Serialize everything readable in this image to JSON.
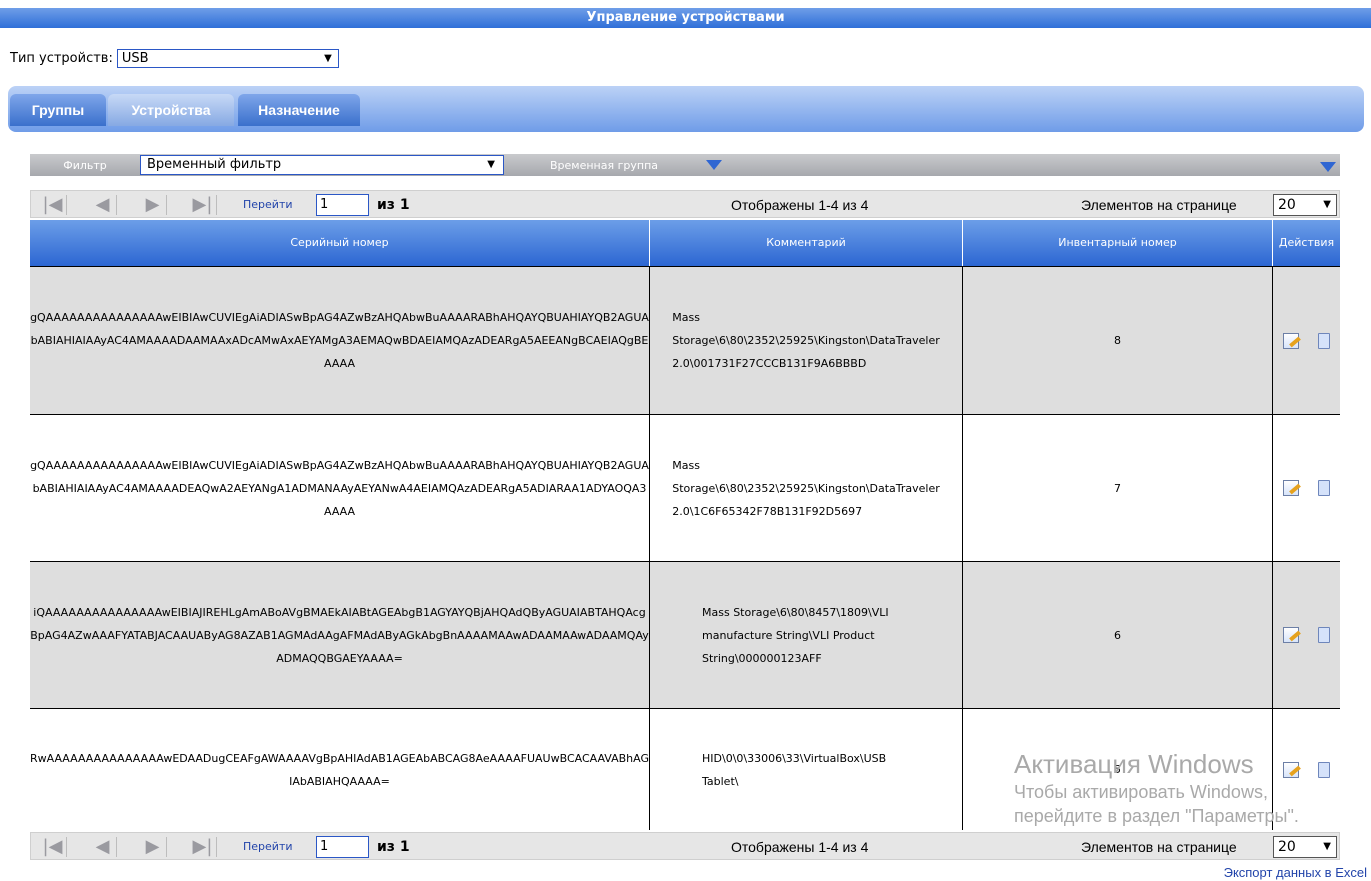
{
  "app": {
    "title": "Управление устройствами"
  },
  "device_type": {
    "label": "Тип устройств:",
    "value": "USB"
  },
  "tabs": [
    {
      "label": "Группы"
    },
    {
      "label": "Устройства"
    },
    {
      "label": "Назначение"
    }
  ],
  "filter": {
    "label": "Фильтр",
    "value": "Временный фильтр",
    "group_label": "Временная группа"
  },
  "pager": {
    "goto_label": "Перейти",
    "page_value": "1",
    "of_label": "из 1",
    "shown_text": "Отображены 1-4 из 4",
    "per_page_label": "Элементов на странице",
    "per_page_value": "20"
  },
  "table": {
    "columns": [
      "Серийный номер",
      "Комментарий",
      "Инвентарный номер",
      "Действия"
    ],
    "rows": [
      {
        "serial": "gQAAAAAAAAAAAAAAAwEIBIAwCUVIEgAiADIASwBpAG4AZwBzAHQAbwBuAAAARABhAHQAYQBUAHIAYQB2AGUAbABIAHIAIAAyAC4AMAAAADAAMAAxADcAMwAxAEYAMgA3AEMAQwBDAEIAMQAzADEARgA5AEEANgBCAEIAQgBEAAAA",
        "comment": "Mass Storage\\6\\80\\2352\\25925\\Kingston\\DataTraveler 2.0\\001731F27CCCB131F9A6BBBD",
        "inventory": "8"
      },
      {
        "serial": "gQAAAAAAAAAAAAAAAwEIBIAwCUVIEgAiADIASwBpAG4AZwBzAHQAbwBuAAAARABhAHQAYQBUAHIAYQB2AGUAbABIAHIAIAAyAC4AMAAAADEAQwA2AEYANgA1ADMANAAyAEYANwA4AEIAMQAzADEARgA5ADIARAA1ADYAOQA3AAAA",
        "comment": "Mass Storage\\6\\80\\2352\\25925\\Kingston\\DataTraveler 2.0\\1C6F65342F78B131F92D5697",
        "inventory": "7"
      },
      {
        "serial": "iQAAAAAAAAAAAAAAAwEIBIAJIREHLgAmABoAVgBMAEkAIABtAGEAbgB1AGYAYQBjAHQAdQByAGUAIABTAHQAcgBpAG4AZwAAAFYATABJACAAUAByAG8AZAB1AGMAdAAgAFMAdAByAGkAbgBnAAAAMAAwADAAMAAwADAAMQAyADMAQQBGAEYAAAA=",
        "comment": "Mass Storage\\6\\80\\8457\\1809\\VLI manufacture String\\VLI Product String\\000000123AFF",
        "inventory": "6"
      },
      {
        "serial": "RwAAAAAAAAAAAAAAAwEDAADugCEAFgAWAAAAVgBpAHIAdAB1AGEAbABCAG8AeAAAAFUAUwBCACAAVABhAGIAbABIAHQAAAA=",
        "comment": "HID\\0\\0\\33006\\33\\VirtualBox\\USB Tablet\\",
        "inventory": "5"
      }
    ]
  },
  "watermark": {
    "line1": "Активация Windows",
    "line2": "Чтобы активировать Windows,",
    "line3": "перейдите в раздел \"Параметры\"."
  },
  "export_label": "Экспорт данных в Excel"
}
